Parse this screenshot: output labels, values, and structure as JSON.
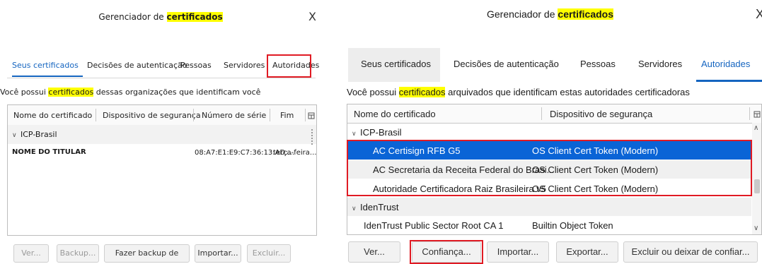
{
  "left_window": {
    "title_before": "Gerenciador de",
    "title_highlight": "certificados",
    "close": "X",
    "tabs": [
      {
        "label": "Seus certificados",
        "active": true
      },
      {
        "label": "Decisões de autenticação",
        "active": false
      },
      {
        "label": "Pessoas",
        "active": false
      },
      {
        "label": "Servidores",
        "active": false
      },
      {
        "label": "Autoridades",
        "active": false
      }
    ],
    "description_before": "Você possui",
    "description_highlight": "certificados",
    "description_after": "dessas organizações que identificam você",
    "columns": [
      "Nome do certificado",
      "Dispositivo de segurança",
      "Número de série",
      "Fim"
    ],
    "group": "ICP-Brasil",
    "row": {
      "name": "NOME DO TITULAR",
      "device": "",
      "serial": "08:A7:E1:E9:C7:36:13:AD:...",
      "end": "terça-feira..."
    },
    "buttons": [
      {
        "label": "Ver...",
        "enabled": false
      },
      {
        "label": "Backup...",
        "enabled": false
      },
      {
        "label": "Fazer backup de tudo...",
        "enabled": true
      },
      {
        "label": "Importar...",
        "enabled": true
      },
      {
        "label": "Excluir...",
        "enabled": false
      }
    ]
  },
  "right_window": {
    "title_before": "Gerenciador de",
    "title_highlight": "certificados",
    "close": "X",
    "tabs": [
      {
        "label": "Seus certificados",
        "active": false
      },
      {
        "label": "Decisões de autenticação",
        "active": false
      },
      {
        "label": "Pessoas",
        "active": false
      },
      {
        "label": "Servidores",
        "active": false
      },
      {
        "label": "Autoridades",
        "active": true
      }
    ],
    "description_before": "Você possui",
    "description_highlight": "certificados",
    "description_after": "arquivados que identificam estas autoridades certificadoras",
    "columns": [
      "Nome do certificado",
      "Dispositivo de segurança"
    ],
    "groups": [
      {
        "name": "ICP-Brasil",
        "rows": [
          {
            "name": "AC Certisign RFB G5",
            "device": "OS Client Cert Token (Modern)",
            "selected": true
          },
          {
            "name": "AC Secretaria da Receita Federal do Brasi...",
            "device": "OS Client Cert Token (Modern)",
            "selected": false
          },
          {
            "name": "Autoridade Certificadora Raiz Brasileira v5",
            "device": "OS Client Cert Token (Modern)",
            "selected": false
          }
        ]
      },
      {
        "name": "IdenTrust",
        "rows": [
          {
            "name": "IdenTrust Public Sector Root CA 1",
            "device": "Builtin Object Token",
            "selected": false
          }
        ]
      }
    ],
    "buttons": [
      {
        "label": "Ver..."
      },
      {
        "label": "Confiança..."
      },
      {
        "label": "Importar..."
      },
      {
        "label": "Exportar..."
      },
      {
        "label": "Excluir ou deixar de confiar..."
      }
    ]
  },
  "colors": {
    "highlight": "#ffff00",
    "selection": "#0a64d6",
    "active_tab": "#1565c0",
    "annotation_red": "#e01b24"
  }
}
